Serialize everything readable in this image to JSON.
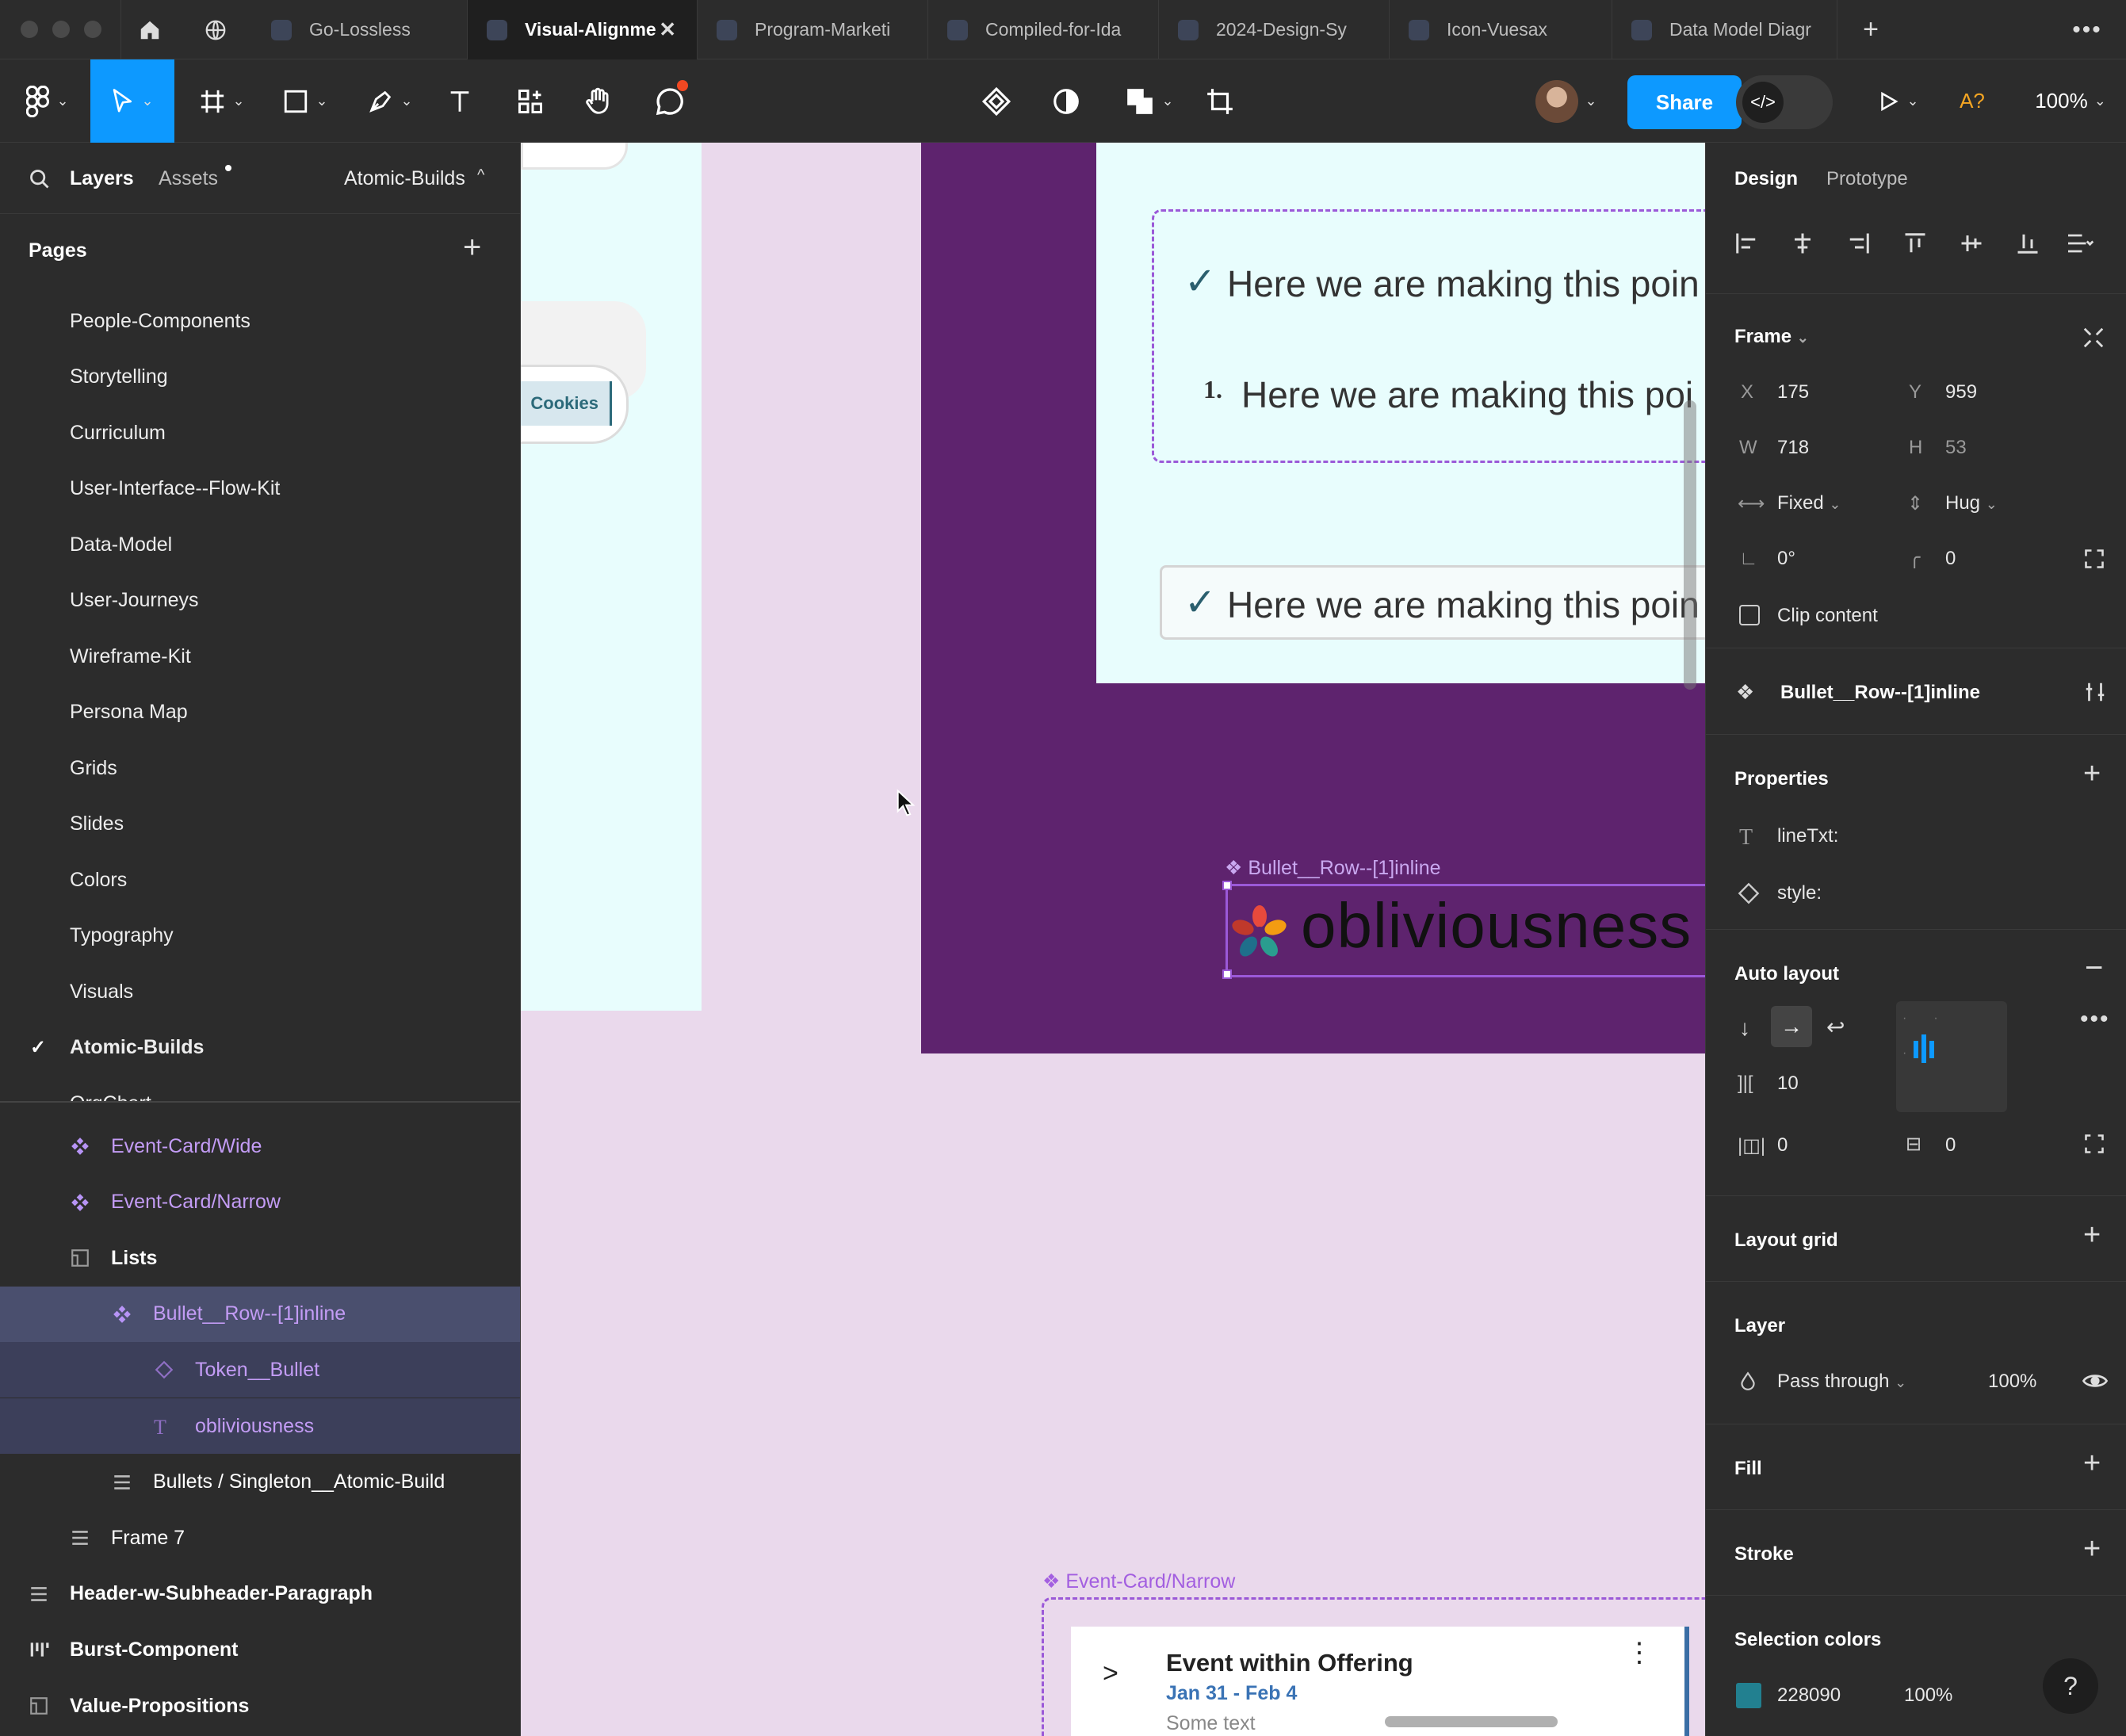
{
  "tabs": [
    {
      "label": "Go-Lossless"
    },
    {
      "label": "Visual-Alignme"
    },
    {
      "label": "Program-Marketi"
    },
    {
      "label": "Compiled-for-Ida"
    },
    {
      "label": "2024-Design-Sy"
    },
    {
      "label": "Icon-Vuesax"
    },
    {
      "label": "Data Model Diagr"
    }
  ],
  "toolbar": {
    "share_label": "Share",
    "font_missing_label": "A?",
    "zoom": "100%"
  },
  "left_panel": {
    "layers_tab": "Layers",
    "assets_tab": "Assets",
    "current_page": "Atomic-Builds",
    "pages_title": "Pages",
    "pages": [
      "People-Components",
      "Storytelling",
      "Curriculum",
      "User-Interface--Flow-Kit",
      "Data-Model",
      "User-Journeys",
      "Wireframe-Kit",
      "Persona Map",
      "Grids",
      "Slides",
      "Colors",
      "Typography",
      "Visuals",
      "Atomic-Builds",
      "OrgChart"
    ],
    "layers": [
      {
        "label": "Event-Card/Wide"
      },
      {
        "label": "Event-Card/Narrow"
      },
      {
        "label": "Lists"
      },
      {
        "label": "Bullet__Row--[1]inline"
      },
      {
        "label": "Token__Bullet"
      },
      {
        "label": "obliviousness"
      },
      {
        "label": "Bullets / Singleton__Atomic-Build"
      },
      {
        "label": "Frame 7"
      },
      {
        "label": "Header-w-Subheader-Paragraph"
      },
      {
        "label": "Burst-Component"
      },
      {
        "label": "Value-Propositions"
      }
    ]
  },
  "canvas": {
    "cookies_label": "Cookies",
    "bullet_text_1": "Here we are making this poin",
    "bullet_text_2": "Here we are making this poi",
    "bullet_text_3": "Here we are making this poin",
    "checkmark": "✓",
    "number_marker": "1.",
    "component_label": "Bullet__Row--[1]inline",
    "big_word": "obliviousness",
    "event_card_label": "Event-Card/Narrow",
    "event_title": "Event within Offering",
    "event_dates": "Jan 31 - Feb 4",
    "event_sub": "Some text"
  },
  "right_panel": {
    "design_tab": "Design",
    "prototype_tab": "Prototype",
    "frame_title": "Frame",
    "x_label": "X",
    "x_value": "175",
    "y_label": "Y",
    "y_value": "959",
    "w_label": "W",
    "w_value": "718",
    "h_label": "H",
    "h_value": "53",
    "width_mode": "Fixed",
    "height_mode": "Hug",
    "rotation": "0°",
    "radius": "0",
    "clip_content": "Clip content",
    "component_name": "Bullet__Row--[1]inline",
    "properties_title": "Properties",
    "prop_1": "lineTxt:",
    "prop_2": "style:",
    "autolayout_title": "Auto layout",
    "gap": "10",
    "pad_h": "0",
    "pad_v": "0",
    "layout_grid_title": "Layout grid",
    "layer_title": "Layer",
    "blend_mode": "Pass through",
    "opacity": "100%",
    "fill_title": "Fill",
    "stroke_title": "Stroke",
    "selection_colors_title": "Selection colors",
    "color_hex": "228090",
    "color_opacity": "100%",
    "help": "?"
  },
  "colors": {
    "selection_swatch": "#228090",
    "accent": "#0d99ff",
    "component": "#b794f6"
  }
}
